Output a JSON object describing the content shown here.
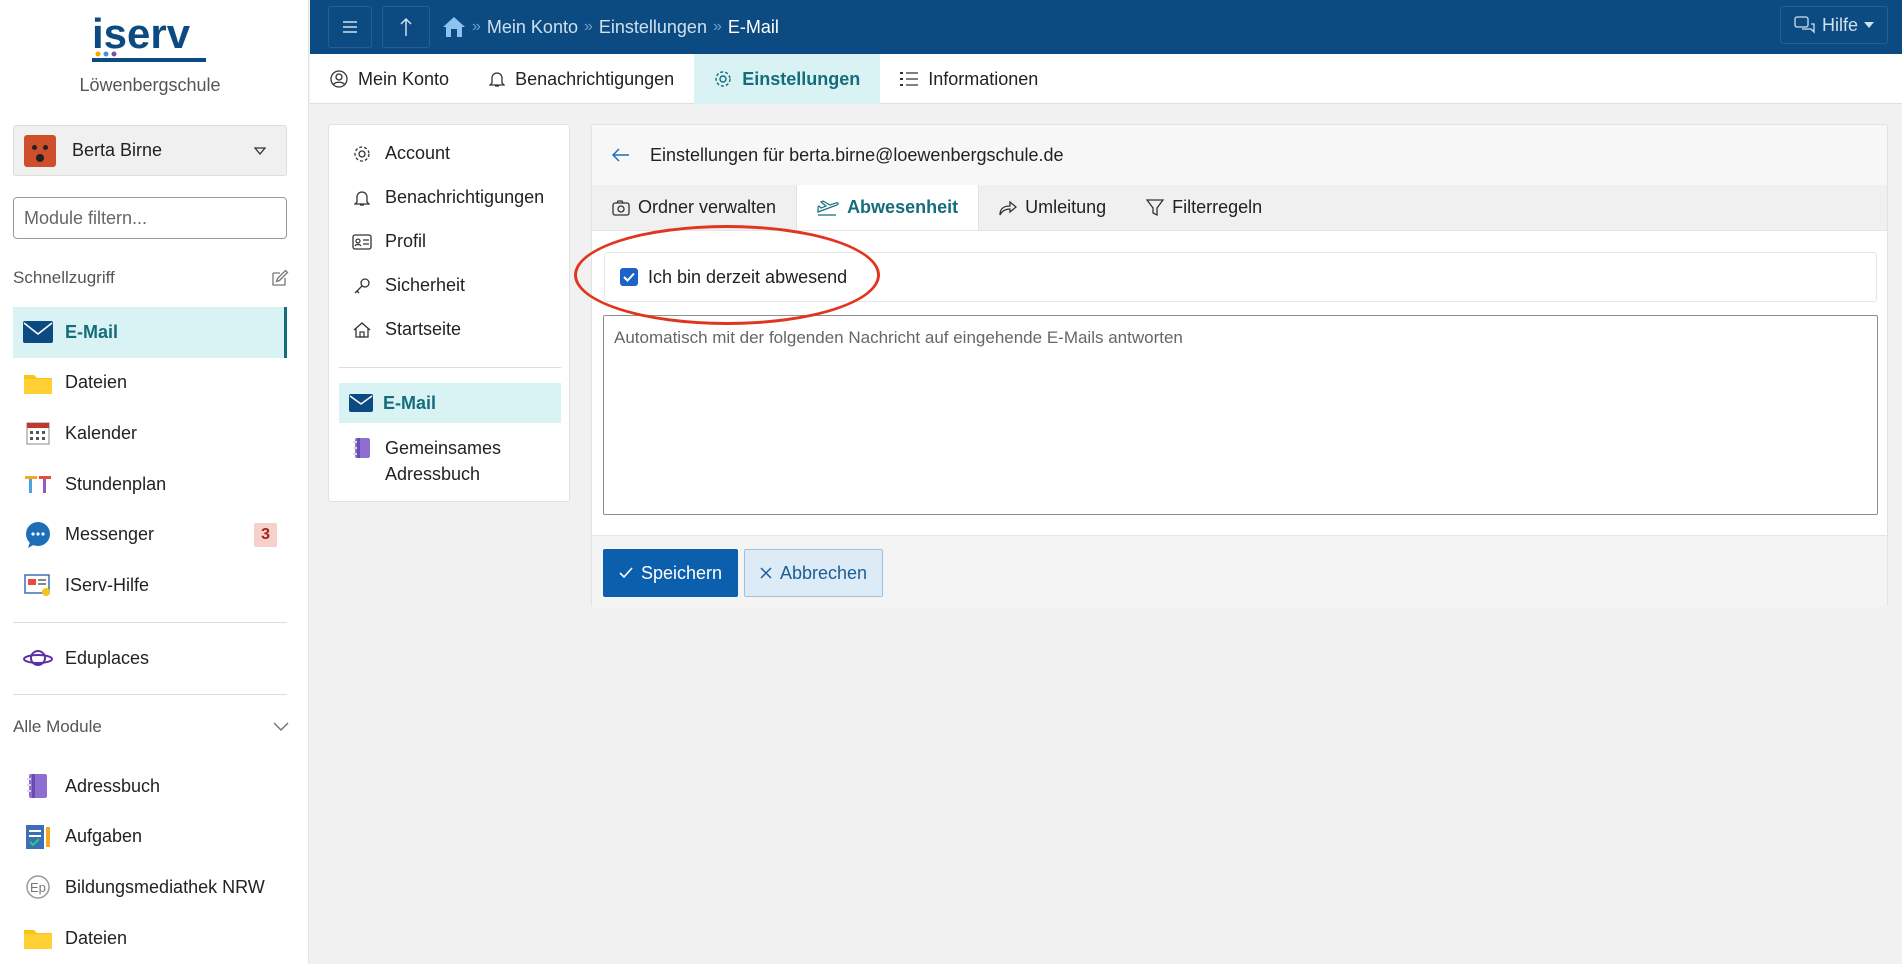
{
  "app": {
    "logo_text": "iserv",
    "school": "Löwenbergschule"
  },
  "user": {
    "name": "Berta Birne"
  },
  "sidebar": {
    "filter_placeholder": "Module filtern...",
    "quick_access_label": "Schnellzugriff",
    "quick_items": [
      {
        "label": "E-Mail",
        "icon": "mail-icon",
        "active": true
      },
      {
        "label": "Dateien",
        "icon": "folder-icon"
      },
      {
        "label": "Kalender",
        "icon": "calendar-icon"
      },
      {
        "label": "Stundenplan",
        "icon": "timetable-icon"
      },
      {
        "label": "Messenger",
        "icon": "chat-icon",
        "badge": "3"
      },
      {
        "label": "IServ-Hilfe",
        "icon": "help-doc-icon"
      }
    ],
    "eduplaces_label": "Eduplaces",
    "all_modules_label": "Alle Module",
    "all_items": [
      {
        "label": "Adressbuch",
        "icon": "addressbook-icon"
      },
      {
        "label": "Aufgaben",
        "icon": "tasks-icon"
      },
      {
        "label": "Bildungsmediathek NRW",
        "icon": "mediathek-icon"
      },
      {
        "label": "Dateien",
        "icon": "folder-icon"
      }
    ]
  },
  "topbar": {
    "breadcrumb": [
      "Mein Konto",
      "Einstellungen",
      "E-Mail"
    ],
    "help_label": "Hilfe"
  },
  "tabs": [
    {
      "label": "Mein Konto",
      "icon": "user-circle-icon"
    },
    {
      "label": "Benachrichtigungen",
      "icon": "bell-icon"
    },
    {
      "label": "Einstellungen",
      "icon": "gear-icon",
      "active": true
    },
    {
      "label": "Informationen",
      "icon": "list-icon"
    }
  ],
  "settings_nav": {
    "items": [
      {
        "label": "Account",
        "icon": "gear-icon"
      },
      {
        "label": "Benachrichtigungen",
        "icon": "bell-icon"
      },
      {
        "label": "Profil",
        "icon": "id-card-icon"
      },
      {
        "label": "Sicherheit",
        "icon": "key-icon"
      },
      {
        "label": "Startseite",
        "icon": "home-icon"
      }
    ],
    "active_label": "E-Mail",
    "address_book_line1": "Gemeinsames",
    "address_book_line2": "Adressbuch"
  },
  "panel": {
    "title": "Einstellungen für berta.birne@loewenbergschule.de",
    "tabs": [
      {
        "label": "Ordner verwalten",
        "icon": "camera-folder-icon"
      },
      {
        "label": "Abwesenheit",
        "icon": "plane-icon",
        "active": true
      },
      {
        "label": "Umleitung",
        "icon": "forward-icon"
      },
      {
        "label": "Filterregeln",
        "icon": "filter-icon"
      }
    ],
    "absent_label": "Ich bin derzeit abwesend",
    "absent_checked": true,
    "message_placeholder": "Automatisch mit der folgenden Nachricht auf eingehende E-Mails antworten",
    "save_label": "Speichern",
    "cancel_label": "Abbrechen"
  },
  "colors": {
    "brand": "#0c4a82",
    "accent": "#156d7c",
    "annotation": "#e0361f"
  }
}
